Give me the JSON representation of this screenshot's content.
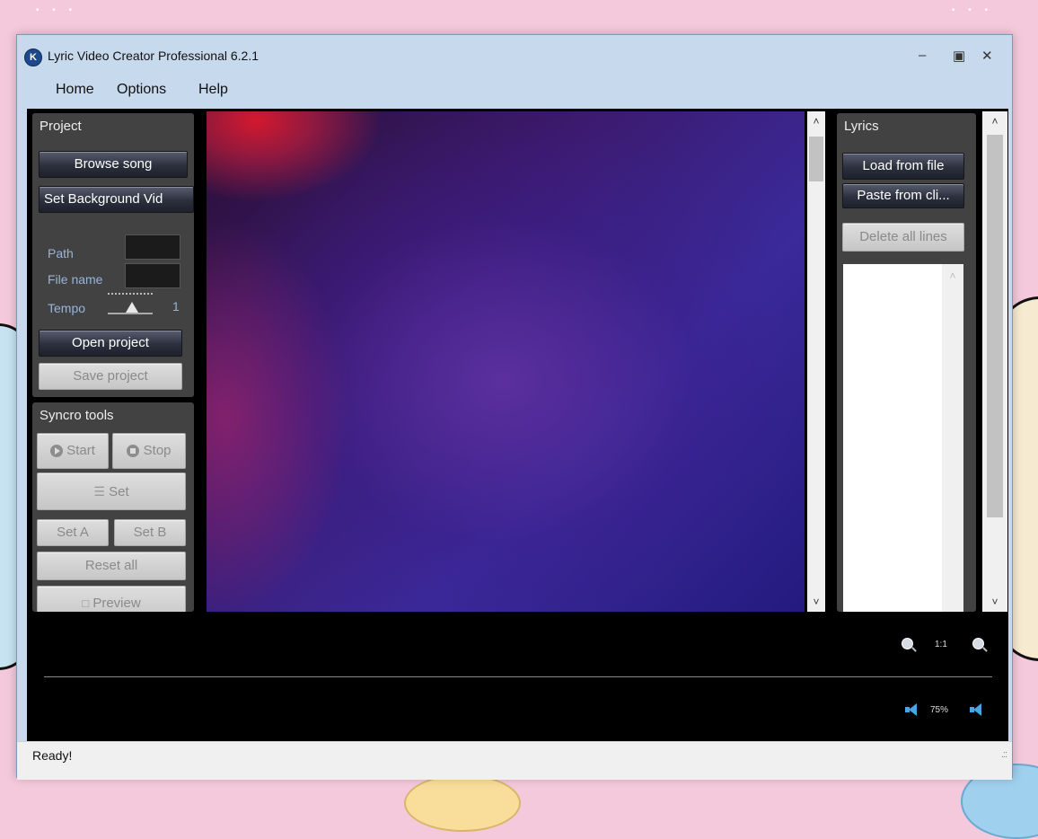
{
  "window": {
    "title": "Lyric Video Creator Professional 6.2.1",
    "controls": {
      "minimize": "‒",
      "maximize": "▣",
      "close": "✕"
    }
  },
  "menu": {
    "items": [
      "Home",
      "Options",
      "Help"
    ]
  },
  "project_panel": {
    "title": "Project",
    "browse_song": "Browse song",
    "set_background": "Set Background Vid",
    "path_label": "Path",
    "file_name_label": "File name",
    "tempo_label": "Tempo",
    "tempo_value": "1",
    "open_project": "Open project",
    "save_project": "Save project"
  },
  "syncro_panel": {
    "title": "Syncro tools",
    "start": "Start",
    "stop": "Stop",
    "set": "Set",
    "set_a": "Set A",
    "set_b": "Set B",
    "reset_all": "Reset all",
    "preview": "Preview"
  },
  "lyrics_panel": {
    "title": "Lyrics",
    "load_from_file": "Load from file",
    "paste_from_clipboard": "Paste from cli...",
    "delete_all_lines": "Delete all lines"
  },
  "timeline": {
    "zoom_ratio": "1:1",
    "volume": "75%"
  },
  "status": {
    "text": "Ready!"
  },
  "colors": {
    "accent": "#47a7e6",
    "panel": "#424242",
    "button_dark": "#2c303d"
  },
  "icons": [
    "app-logo-icon",
    "zoom-in-icon",
    "zoom-out-icon",
    "volume-up-icon",
    "volume-down-icon",
    "start-icon",
    "stop-icon",
    "set-icon",
    "preview-icon"
  ]
}
